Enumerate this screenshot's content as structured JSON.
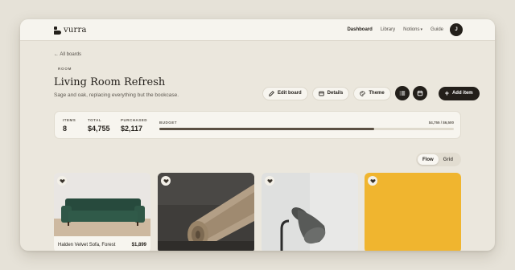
{
  "app": {
    "name": "vurra"
  },
  "nav": {
    "items": [
      {
        "label": "Dashboard",
        "active": true
      },
      {
        "label": "Library",
        "active": false
      },
      {
        "label": "Notions",
        "active": false,
        "dropdown": true
      },
      {
        "label": "Guide",
        "active": false
      }
    ],
    "avatar_initial": "J"
  },
  "page": {
    "back_link": "All boards",
    "eyebrow": "ROOM",
    "title": "Living Room Refresh",
    "subtitle": "Sage and oak, replacing everything but the bookcase."
  },
  "actions": {
    "edit_board": "Edit board",
    "details": "Details",
    "theme": "Theme",
    "view_list_icon": "list-icon",
    "view_calendar_icon": "calendar-icon",
    "add_item": "Add item"
  },
  "stats": {
    "items_label": "ITEMS",
    "items_value": "8",
    "total_label": "TOTAL",
    "total_value": "$4,755",
    "purchased_label": "PURCHASED",
    "purchased_value": "$2,117",
    "budget_label": "BUDGET",
    "budget_text": "$4,755 / $6,500",
    "budget_fraction": 0.73
  },
  "view_toggle": {
    "flow": "Flow",
    "grid": "Grid",
    "selected": "Flow"
  },
  "cards": [
    {
      "name": "Halden Velvet Sofa, Forest",
      "price": "$1,899",
      "image": "green-sofa"
    },
    {
      "name": "",
      "price": "",
      "image": "rolled-rug"
    },
    {
      "name": "",
      "price": "",
      "image": "floor-lamp"
    },
    {
      "name": "",
      "price": "",
      "image": "mustard-panel"
    }
  ],
  "colors": {
    "accent": "#231f1a",
    "background": "#e6e2d8",
    "surface": "#f7f5ef",
    "budget_fill": "#5b5043"
  }
}
